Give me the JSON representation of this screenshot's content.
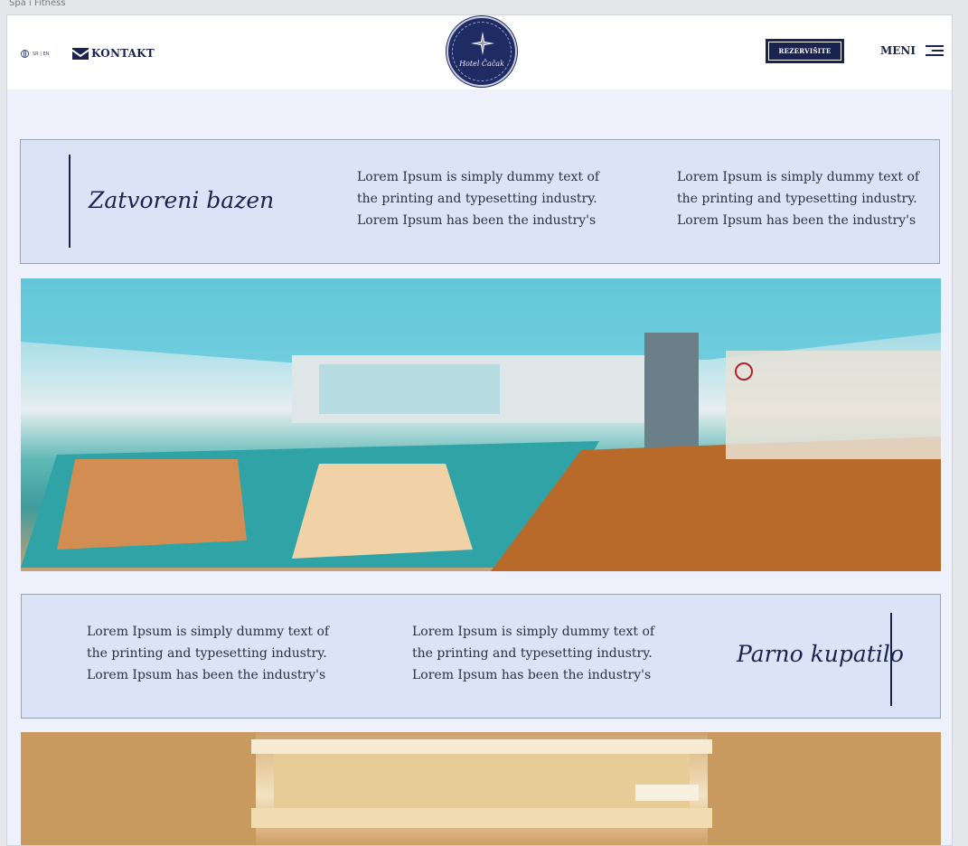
{
  "page_label": "Spa i Fitness",
  "header": {
    "lang": "SR | EN",
    "contact": "KONTAKT",
    "logo_text": "Hotel Čačak",
    "reserve": "REZERVIŠITE",
    "menu": "MENI"
  },
  "sections": [
    {
      "title": "Zatvoreni bazen",
      "paragraphs": [
        "Lorem Ipsum is simply dummy text of the printing and typesetting industry. Lorem Ipsum has been the industry's",
        "Lorem Ipsum is simply dummy text of the printing and typesetting industry. Lorem Ipsum has been the industry's"
      ]
    },
    {
      "title": "Parno kupatilo",
      "paragraphs": [
        "Lorem Ipsum is simply dummy text of the printing and typesetting industry. Lorem Ipsum has been the industry's",
        "Lorem Ipsum is simply dummy text of the printing and typesetting industry. Lorem Ipsum has been the industry's"
      ]
    }
  ],
  "colors": {
    "navy": "#1a2350",
    "band": "#dbe3f6",
    "page": "#eef1fb"
  },
  "icons": [
    "globe-icon",
    "mail-icon",
    "compass-star-icon",
    "hamburger-icon"
  ]
}
